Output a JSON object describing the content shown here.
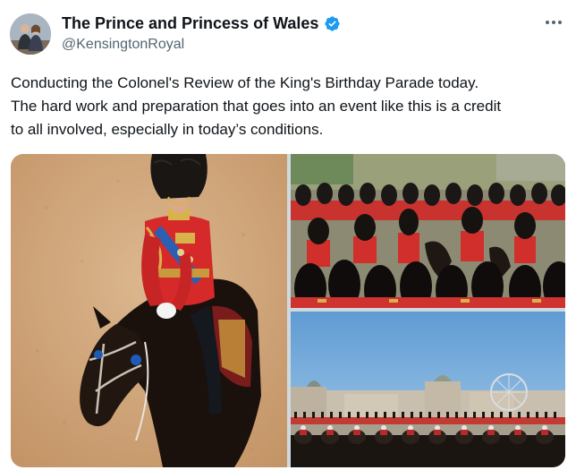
{
  "tweet": {
    "display_name": "The Prince and Princess of Wales",
    "handle": "@KensingtonRoyal",
    "verified": true,
    "more_icon": "more-horizontal-icon",
    "text": "Conducting the Colonel's Review of the King's Birthday Parade today.\nThe hard work and preparation that goes into an event like this is a credit\nto all involved, especially in today’s conditions."
  },
  "colors": {
    "text_primary": "#0f1419",
    "text_secondary": "#536471",
    "verified_badge": "#1d9bf0",
    "tunic_red": "#d62a2a",
    "bearskin": "#1a1614",
    "parade_sand": "#cfa57a",
    "sky": "#7fb2dc"
  },
  "media": {
    "count": 3,
    "layout": "one-left-two-right"
  }
}
